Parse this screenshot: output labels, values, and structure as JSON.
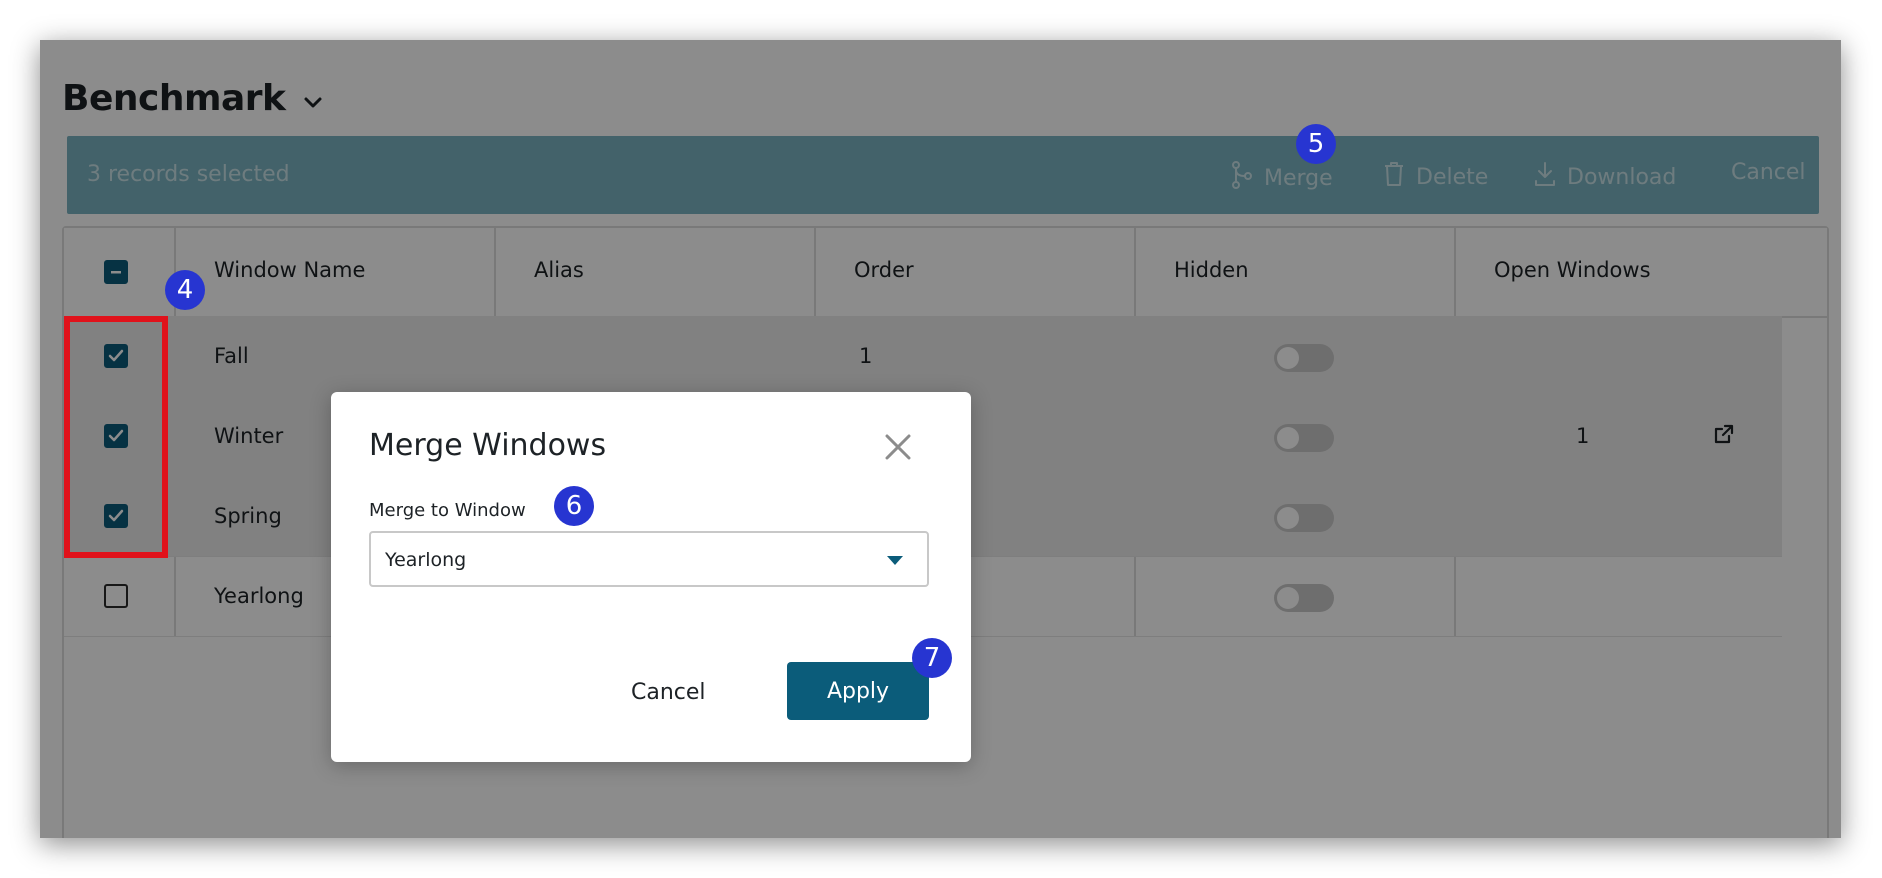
{
  "page": {
    "title": "Benchmark"
  },
  "selection_bar": {
    "count_label": "3 records selected",
    "actions": {
      "merge": "Merge",
      "delete": "Delete",
      "download": "Download",
      "cancel": "Cancel"
    }
  },
  "table": {
    "columns": [
      "Window Name",
      "Alias",
      "Order",
      "Hidden",
      "Open Windows"
    ],
    "rows": [
      {
        "name": "Fall",
        "alias": "",
        "order": "1",
        "hidden": false,
        "open_windows": "",
        "selected": true
      },
      {
        "name": "Winter",
        "alias": "",
        "order": "",
        "hidden": false,
        "open_windows": "1",
        "selected": true
      },
      {
        "name": "Spring",
        "alias": "",
        "order": "",
        "hidden": false,
        "open_windows": "",
        "selected": true
      },
      {
        "name": "Yearlong",
        "alias": "",
        "order": "",
        "hidden": false,
        "open_windows": "",
        "selected": false
      }
    ]
  },
  "modal": {
    "title": "Merge Windows",
    "field_label": "Merge to Window",
    "select_value": "Yearlong",
    "cancel_label": "Cancel",
    "apply_label": "Apply"
  },
  "badges": {
    "b4": "4",
    "b5": "5",
    "b6": "6",
    "b7": "7"
  },
  "colors": {
    "accent": "#0b5c7a",
    "selection_bar": "#7ab3c1",
    "highlight": "#e0121b",
    "badge": "#2735d1"
  },
  "icons": [
    "chevron-down-icon",
    "merge-icon",
    "trash-icon",
    "download-icon",
    "close-icon",
    "external-link-icon"
  ]
}
